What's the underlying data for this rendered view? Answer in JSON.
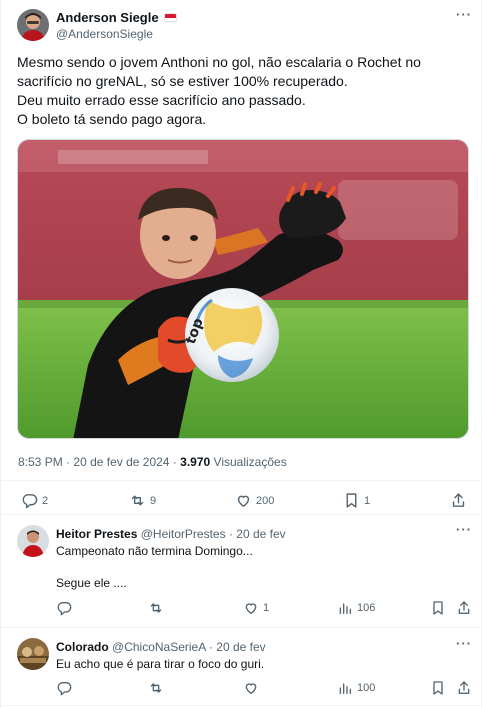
{
  "tweet": {
    "author_name": "Anderson Siegle",
    "author_handle": "@AndersonSiegle",
    "more_label": "···",
    "lines": [
      "Mesmo sendo o jovem Anthoni no gol, não escalaria o Rochet no",
      "sacrifício no greNAL, só se estiver 100% recuperado.",
      "Deu muito errado esse sacrifício ano passado.",
      "O boleto tá sendo pago agora."
    ],
    "time": "8:53 PM",
    "dot1": "·",
    "date": "20 de fev de 2024",
    "dot2": "·",
    "views_count": "3.970",
    "views_label": "Visualizações",
    "stats": {
      "replies": "2",
      "reposts": "9",
      "likes": "200",
      "bookmarks": "1"
    }
  },
  "replies": [
    {
      "name": "Heitor Prestes",
      "handle": "@HeitorPrestes",
      "sep": "·",
      "date": "20 de fev",
      "lines": [
        "Campeonato não termina Domingo...",
        "",
        "Segue ele ...."
      ],
      "likes": "1",
      "views": "106"
    },
    {
      "name": "Colorado",
      "handle": "@ChicoNaSerieA",
      "sep": "·",
      "date": "20 de fev",
      "lines": [
        "Eu acho que é para tirar o foco do guri."
      ],
      "likes": "",
      "views": "100"
    }
  ],
  "colors": {
    "text": "#0f1419",
    "secondary": "#536471",
    "border": "#eff3f4",
    "flag_red": "#d7192f"
  },
  "icons": [
    "reply-icon",
    "repost-icon",
    "like-icon",
    "bookmark-icon",
    "share-icon",
    "views-icon",
    "more-icon"
  ]
}
